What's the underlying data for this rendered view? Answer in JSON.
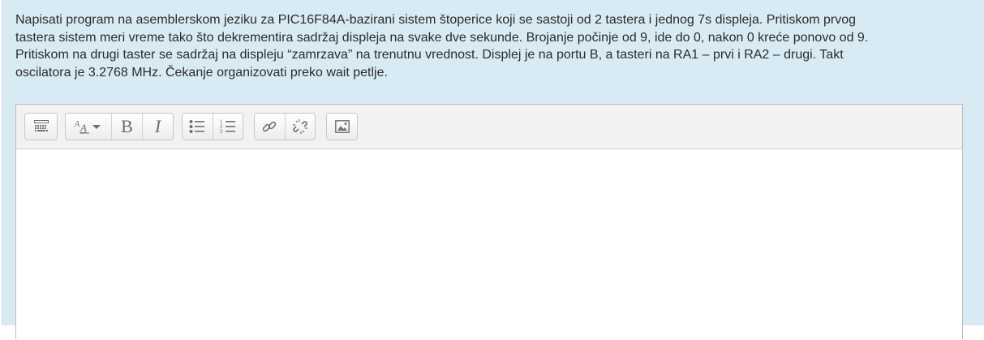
{
  "question": {
    "text_lines": [
      "Napisati program na asemblerskom jeziku za PIC16F84A-bazirani sistem štoperice koji se sastoji od 2 tastera i jednog 7s displeja. Pritiskom prvog",
      "tastera sistem meri vreme tako što dekrementira sadržaj displeja na svake dve sekunde. Brojanje počinje od 9, ide do 0, nakon 0 kreće ponovo od 9.",
      "Pritiskom na drugi taster se sadržaj na displeju “zamrzava” na trenutnu vrednost. Displej je na portu B, a tasteri na RA1 – prvi i RA2 – drugi. Takt",
      "oscilatora je 3.2768 MHz.  Čekanje organizovati preko wait petlje."
    ]
  },
  "editor": {
    "toolbar": {
      "show_more_icon": "toolbar-toggle-icon",
      "font_style_icon": "font-style-dropdown-icon",
      "bold_label": "B",
      "italic_label": "I",
      "unordered_list_icon": "bullet-list-icon",
      "ordered_list_icon": "numbered-list-icon",
      "link_icon": "link-icon",
      "unlink_icon": "unlink-icon",
      "image_icon": "image-icon"
    },
    "content": ""
  },
  "colors": {
    "panel_background": "#d8ebf5",
    "toolbar_background": "#f2f2f2",
    "icon_color": "#6b6b6b",
    "text_color": "#2b2b2b"
  }
}
